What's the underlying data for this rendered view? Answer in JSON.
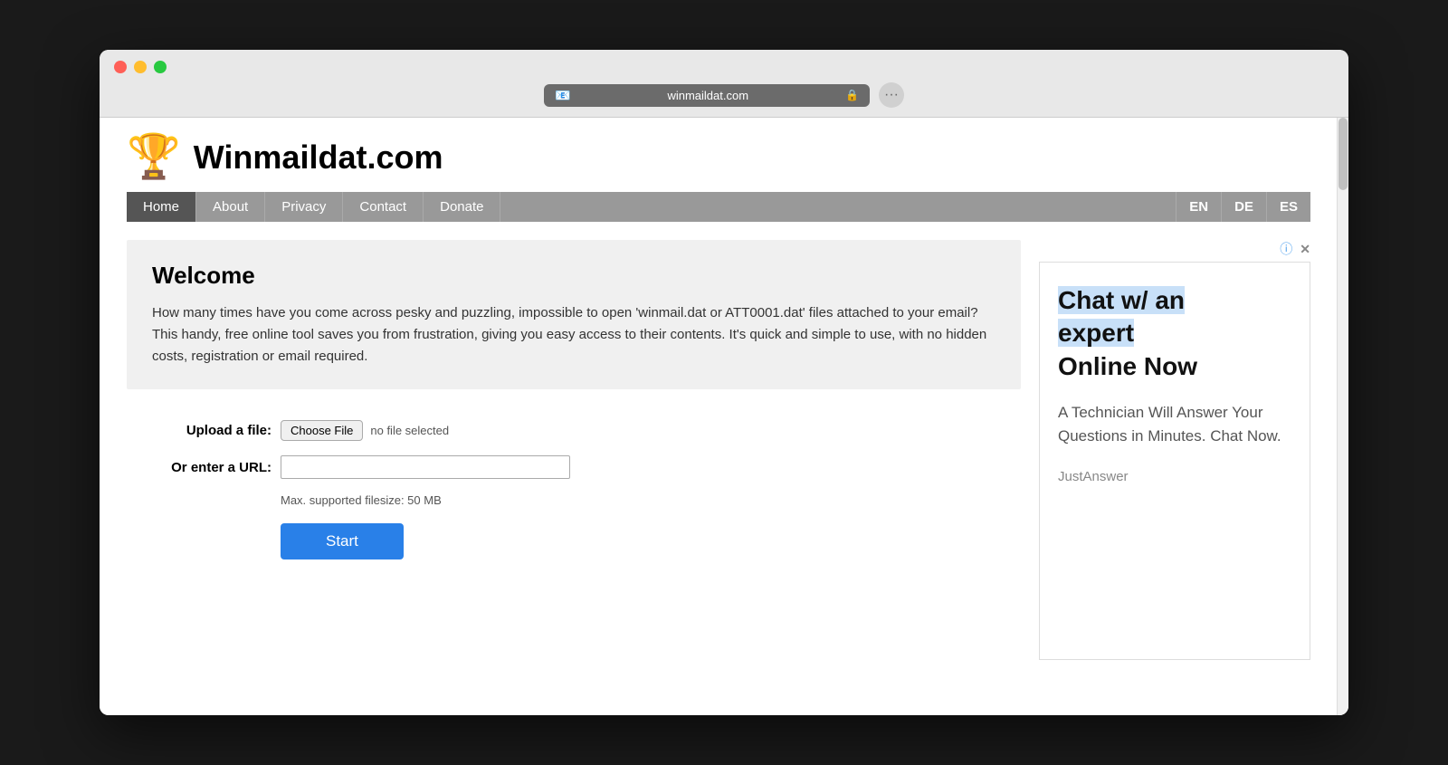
{
  "browser": {
    "url": "winmaildat.com",
    "lock_icon": "🔒",
    "favicon": "📧"
  },
  "site": {
    "logo": "🏆",
    "title": "Winmaildat.com"
  },
  "nav": {
    "items": [
      {
        "label": "Home",
        "active": true
      },
      {
        "label": "About",
        "active": false
      },
      {
        "label": "Privacy",
        "active": false
      },
      {
        "label": "Contact",
        "active": false
      },
      {
        "label": "Donate",
        "active": false
      }
    ],
    "languages": [
      {
        "label": "EN"
      },
      {
        "label": "DE"
      },
      {
        "label": "ES"
      }
    ]
  },
  "welcome": {
    "title": "Welcome",
    "text": "How many times have you come across pesky and puzzling, impossible to open 'winmail.dat or ATT0001.dat' files attached to your email? This handy, free online tool saves you from frustration, giving you easy access to their contents. It's quick and simple to use, with no hidden costs, registration or email required."
  },
  "form": {
    "upload_label": "Upload a file:",
    "choose_file_label": "Choose File",
    "no_file_text": "no file selected",
    "url_label": "Or enter a URL:",
    "url_placeholder": "",
    "filesize_note": "Max. supported filesize: 50 MB",
    "start_label": "Start"
  },
  "ad": {
    "headline_part1": "Chat w/ an",
    "headline_part2": "expert",
    "headline_part3": "Online Now",
    "subtext": "A Technician Will Answer Your Questions in Minutes. Chat Now.",
    "brand": "JustAnswer"
  }
}
